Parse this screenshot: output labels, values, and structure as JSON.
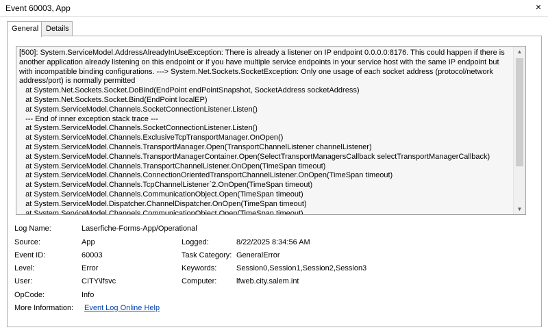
{
  "window": {
    "title": "Event 60003, App",
    "close_glyph": "×"
  },
  "tabs": [
    {
      "label": "General",
      "active": true
    },
    {
      "label": "Details",
      "active": false
    }
  ],
  "description": "[500]: System.ServiceModel.AddressAlreadyInUseException: There is already a listener on IP endpoint 0.0.0.0:8176. This could happen if there is another application already listening on this endpoint or if you have multiple service endpoints in your service host with the same IP endpoint but with incompatible binding configurations. ---> System.Net.Sockets.SocketException: Only one usage of each socket address (protocol/network address/port) is normally permitted\n   at System.Net.Sockets.Socket.DoBind(EndPoint endPointSnapshot, SocketAddress socketAddress)\n   at System.Net.Sockets.Socket.Bind(EndPoint localEP)\n   at System.ServiceModel.Channels.SocketConnectionListener.Listen()\n   --- End of inner exception stack trace ---\n   at System.ServiceModel.Channels.SocketConnectionListener.Listen()\n   at System.ServiceModel.Channels.ExclusiveTcpTransportManager.OnOpen()\n   at System.ServiceModel.Channels.TransportManager.Open(TransportChannelListener channelListener)\n   at System.ServiceModel.Channels.TransportManagerContainer.Open(SelectTransportManagersCallback selectTransportManagerCallback)\n   at System.ServiceModel.Channels.TransportChannelListener.OnOpen(TimeSpan timeout)\n   at System.ServiceModel.Channels.ConnectionOrientedTransportChannelListener.OnOpen(TimeSpan timeout)\n   at System.ServiceModel.Channels.TcpChannelListener`2.OnOpen(TimeSpan timeout)\n   at System.ServiceModel.Channels.CommunicationObject.Open(TimeSpan timeout)\n   at System.ServiceModel.Dispatcher.ChannelDispatcher.OnOpen(TimeSpan timeout)\n   at System.ServiceModel.Channels.CommunicationObject.Open(TimeSpan timeout)",
  "fields": {
    "log_name_label": "Log Name:",
    "log_name": "Laserfiche-Forms-App/Operational",
    "source_label": "Source:",
    "source": "App",
    "logged_label": "Logged:",
    "logged": "8/22/2025 8:34:56 AM",
    "event_id_label": "Event ID:",
    "event_id": "60003",
    "task_category_label": "Task Category:",
    "task_category": "GeneralError",
    "level_label": "Level:",
    "level": "Error",
    "keywords_label": "Keywords:",
    "keywords": "Session0,Session1,Session2,Session3",
    "user_label": "User:",
    "user": "CITY\\lfsvc",
    "computer_label": "Computer:",
    "computer": "lfweb.city.salem.int",
    "opcode_label": "OpCode:",
    "opcode": "Info",
    "more_info_label": "More Information:",
    "more_info_link": "Event Log Online Help"
  },
  "icons": {
    "scroll_up": "▲",
    "scroll_down": "▼"
  }
}
